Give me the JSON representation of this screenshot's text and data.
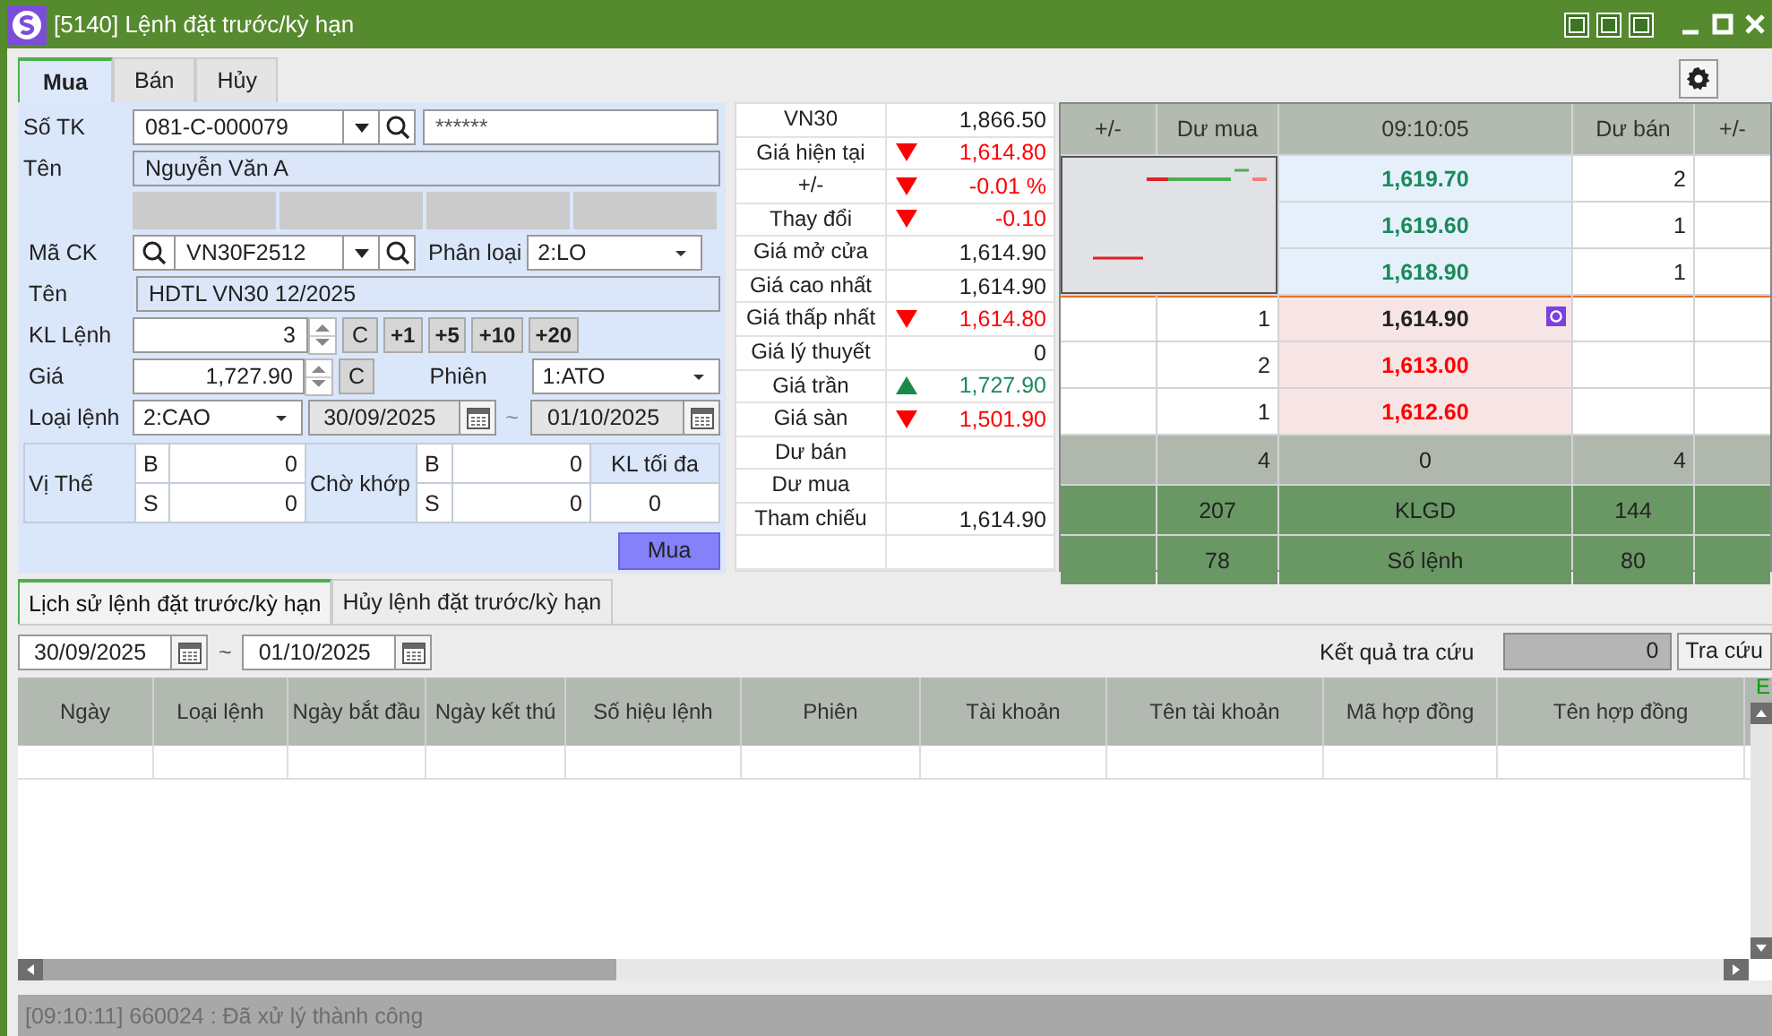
{
  "window": {
    "title": "[5140] Lệnh đặt trước/kỳ hạn"
  },
  "order_tabs": [
    {
      "label": "Mua",
      "selected": true
    },
    {
      "label": "Bán",
      "selected": false
    },
    {
      "label": "Hủy",
      "selected": false
    }
  ],
  "form": {
    "account": {
      "label": "Số TK",
      "value": "081-C-000079",
      "password": "******"
    },
    "account_name": {
      "label": "Tên",
      "value": "Nguyễn Văn A"
    },
    "symbol": {
      "label": "Mã CK",
      "value": "VN30F2512",
      "type_label": "Phân loại",
      "type_value": "2:LO"
    },
    "symbol_name": {
      "label": "Tên",
      "value": "HDTL VN30 12/2025"
    },
    "quantity": {
      "label": "KL Lệnh",
      "value": "3",
      "clear": "C",
      "steps": [
        "+1",
        "+5",
        "+10",
        "+20"
      ]
    },
    "price": {
      "label": "Giá",
      "value": "1,727.90",
      "clear": "C",
      "session_label": "Phiên",
      "session_value": "1:ATO"
    },
    "order_type": {
      "label": "Loại lệnh",
      "value": "2:CAO",
      "from": "30/09/2025",
      "separator": "~",
      "to": "01/10/2025"
    },
    "position": {
      "label": "Vị Thế",
      "buy_letter": "B",
      "buy": "0",
      "sell_letter": "S",
      "sell": "0"
    },
    "pending": {
      "label": "Chờ khớp",
      "buy_letter": "B",
      "buy": "0",
      "sell_letter": "S",
      "sell": "0"
    },
    "max_qty": {
      "label": "KL tối đa",
      "value": "0"
    },
    "submit": "Mua"
  },
  "market_info": [
    {
      "label": "VN30",
      "value": "1,866.50",
      "kind": "flat"
    },
    {
      "label": "Giá hiện tại",
      "value": "1,614.80",
      "kind": "down"
    },
    {
      "label": "+/-",
      "value": "-0.01 %",
      "kind": "down"
    },
    {
      "label": "Thay đổi",
      "value": "-0.10",
      "kind": "down"
    },
    {
      "label": "Giá mở cửa",
      "value": "1,614.90",
      "kind": "flat"
    },
    {
      "label": "Giá cao nhất",
      "value": "1,614.90",
      "kind": "flat"
    },
    {
      "label": "Giá thấp nhất",
      "value": "1,614.80",
      "kind": "down"
    },
    {
      "label": "Giá lý thuyết",
      "value": "0",
      "kind": "flat"
    },
    {
      "label": "Giá trần",
      "value": "1,727.90",
      "kind": "up"
    },
    {
      "label": "Giá sàn",
      "value": "1,501.90",
      "kind": "down"
    },
    {
      "label": "Dư bán",
      "kind": "flat"
    },
    {
      "label": "Dư mua",
      "kind": "flat"
    },
    {
      "label": "Tham chiếu",
      "value": "1,614.90",
      "kind": "flat"
    }
  ],
  "order_book": {
    "columns": [
      "+/-",
      "Dư mua",
      "09:10:05",
      "Dư bán",
      "+/-"
    ],
    "asks": [
      {
        "price": "1,619.70",
        "qty": "2",
        "kind": "up"
      },
      {
        "price": "1,619.60",
        "qty": "1",
        "kind": "up"
      },
      {
        "price": "1,618.90",
        "qty": "1",
        "kind": "up"
      }
    ],
    "bids": [
      {
        "qty": "1",
        "price": "1,614.90",
        "kind": "flat",
        "marked": true
      },
      {
        "qty": "2",
        "price": "1,613.00",
        "kind": "down",
        "marked": false
      },
      {
        "qty": "1",
        "price": "1,612.60",
        "kind": "down",
        "marked": false
      }
    ],
    "totals": {
      "bid": "4",
      "mid": "0",
      "ask": "4"
    },
    "stats": [
      {
        "bid": "207",
        "label": "KLGD",
        "ask": "144"
      },
      {
        "bid": "78",
        "label": "Số lệnh",
        "ask": "80"
      }
    ]
  },
  "history_tabs": [
    {
      "label": "Lịch sử lệnh đặt trước/kỳ hạn",
      "selected": true
    },
    {
      "label": "Hủy lệnh đặt trước/kỳ hạn",
      "selected": false
    }
  ],
  "history_filter": {
    "from": "30/09/2025",
    "separator": "~",
    "to": "01/10/2025",
    "result_label": "Kết quả tra cứu",
    "result_count": "0",
    "search_button": "Tra cứu"
  },
  "history_table": {
    "columns": [
      "Ngày",
      "Loại lệnh",
      "Ngày bắt đầu",
      "Ngày kết thú",
      "Số hiệu lệnh",
      "Phiên",
      "Tài khoản",
      "Tên tài khoản",
      "Mã hợp đồng",
      "Tên hợp đồng"
    ],
    "corner_text": "E"
  },
  "status_bar": {
    "message": "[09:10:11] 660024 : Đã xử lý thành công"
  }
}
